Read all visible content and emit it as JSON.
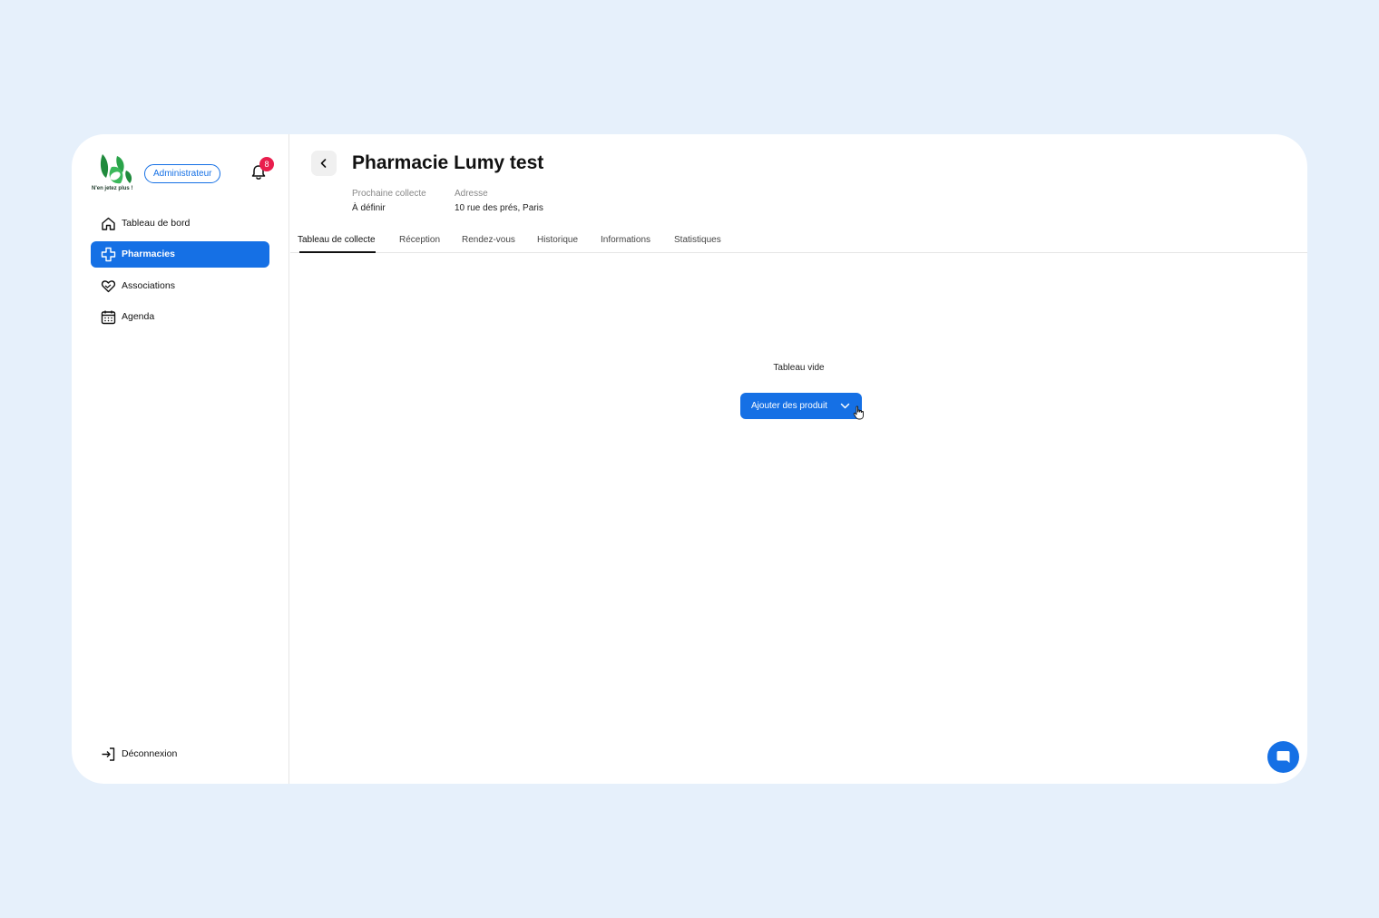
{
  "sidebar": {
    "logo_tagline": "N'en jetez plus !",
    "role_badge": "Administrateur",
    "notification_count": "8",
    "items": [
      {
        "label": "Tableau de bord",
        "icon": "home-icon",
        "active": false
      },
      {
        "label": "Pharmacies",
        "icon": "pharmacy-cross-icon",
        "active": true
      },
      {
        "label": "Associations",
        "icon": "heart-hand-icon",
        "active": false
      },
      {
        "label": "Agenda",
        "icon": "calendar-icon",
        "active": false
      }
    ],
    "logout_label": "Déconnexion"
  },
  "header": {
    "title": "Pharmacie Lumy test",
    "next_collection_label": "Prochaine collecte",
    "next_collection_value": "À définir",
    "address_label": "Adresse",
    "address_value": "10 rue des prés, Paris"
  },
  "tabs": [
    {
      "label": "Tableau de collecte",
      "active": true
    },
    {
      "label": "Réception",
      "active": false
    },
    {
      "label": "Rendez-vous",
      "active": false
    },
    {
      "label": "Historique",
      "active": false
    },
    {
      "label": "Informations",
      "active": false
    },
    {
      "label": "Statistiques",
      "active": false
    }
  ],
  "content": {
    "empty_text": "Tableau vide",
    "add_button_label": "Ajouter des produit"
  },
  "colors": {
    "accent": "#1570e5",
    "badge": "#e91e4d",
    "background": "#e6f0fb"
  }
}
